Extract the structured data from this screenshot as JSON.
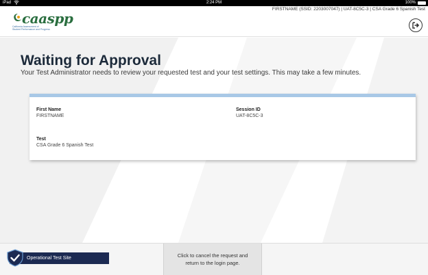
{
  "status_bar": {
    "carrier": "iPad",
    "time": "2:24 PM",
    "battery": "100%"
  },
  "header": {
    "logo_text": "caaspp",
    "logo_tagline_1": "California Assessment of",
    "logo_tagline_2": "Student Performance and Progress",
    "session_info": "FIRSTNAME (SSID: 2203007047) | UAT-8C5C-3 | CSA Grade 6 Spanish Test"
  },
  "main": {
    "title": "Waiting for Approval",
    "subtitle": "Your Test Administrator needs to review your requested test and your test settings. This may take a few minutes.",
    "card": {
      "first_name_label": "First Name",
      "first_name_value": "FIRSTNAME",
      "session_id_label": "Session ID",
      "session_id_value": "UAT-8C5C-3",
      "test_label": "Test",
      "test_value": "CSA Grade 6 Spanish Test"
    }
  },
  "footer": {
    "site_label": "Operational Test Site",
    "cancel_line_1": "Click to cancel the request and",
    "cancel_line_2": "return to the login page."
  },
  "colors": {
    "title": "#1c2a3a",
    "card_accent": "#a8c8e6",
    "badge_bg": "#1c2a52",
    "logo_green": "#2a6e3f"
  },
  "icons": {
    "logout": "logout-icon",
    "wifi": "wifi-icon",
    "battery": "battery-icon",
    "shield": "shield-check-icon"
  }
}
